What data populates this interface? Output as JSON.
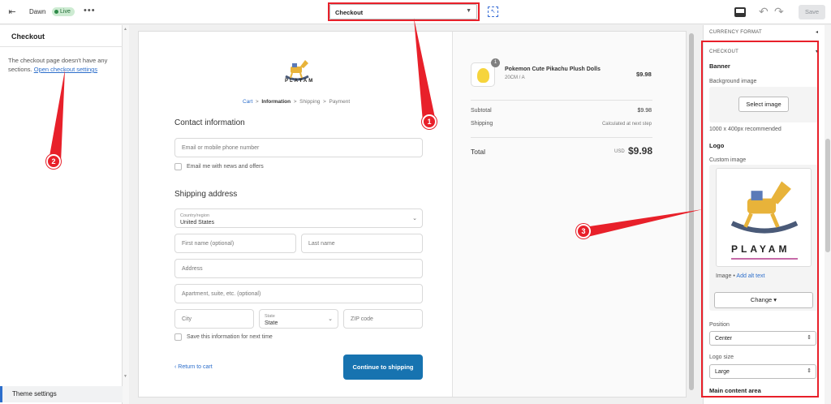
{
  "topbar": {
    "theme_name": "Dawn",
    "live_badge": "Live",
    "more": "•••",
    "page_select": "Checkout",
    "save": "Save"
  },
  "left_panel": {
    "title": "Checkout",
    "message": "The checkout page doesn't have any sections.",
    "link": "Open checkout settings",
    "footer": "Theme settings"
  },
  "preview": {
    "brand": "PLAYAM",
    "breadcrumb": [
      "Cart",
      "Information",
      "Shipping",
      "Payment"
    ],
    "contact_heading": "Contact information",
    "email_placeholder": "Email or mobile phone number",
    "newsletter_label": "Email me with news and offers",
    "shipping_heading": "Shipping address",
    "country_label": "Country/region",
    "country_value": "United States",
    "first_name": "First name (optional)",
    "last_name": "Last name",
    "address": "Address",
    "apartment": "Apartment, suite, etc. (optional)",
    "city": "City",
    "state_label": "State",
    "state_value": "State",
    "zip": "ZIP code",
    "save_info": "Save this information for next time",
    "return_link": "Return to cart",
    "continue_button": "Continue to shipping"
  },
  "order_summary": {
    "product_name": "Pokemon Cute Pikachu Plush Dolls",
    "product_variant": "20CM / A",
    "product_price": "$9.98",
    "quantity": "1",
    "subtotal_label": "Subtotal",
    "subtotal_value": "$9.98",
    "shipping_label": "Shipping",
    "shipping_value": "Calculated at next step",
    "total_label": "Total",
    "total_currency": "USD",
    "total_value": "$9.98"
  },
  "right_panel": {
    "currency_format": "CURRENCY FORMAT",
    "checkout": "CHECKOUT",
    "banner": "Banner",
    "background_image": "Background image",
    "select_image": "Select image",
    "recommended": "1000 x 400px recommended",
    "logo": "Logo",
    "custom_image": "Custom image",
    "logo_brand": "PLAYAM",
    "image_label": "Image •",
    "add_alt_text": "Add alt text",
    "change": "Change",
    "position_label": "Position",
    "position_value": "Center",
    "logo_size_label": "Logo size",
    "logo_size_value": "Large",
    "main_content": "Main content area"
  },
  "annotations": [
    "1",
    "2",
    "3"
  ],
  "colors": {
    "annotation_red": "#e8202a",
    "link_blue": "#2c6ecb",
    "button_blue": "#1773b0"
  }
}
